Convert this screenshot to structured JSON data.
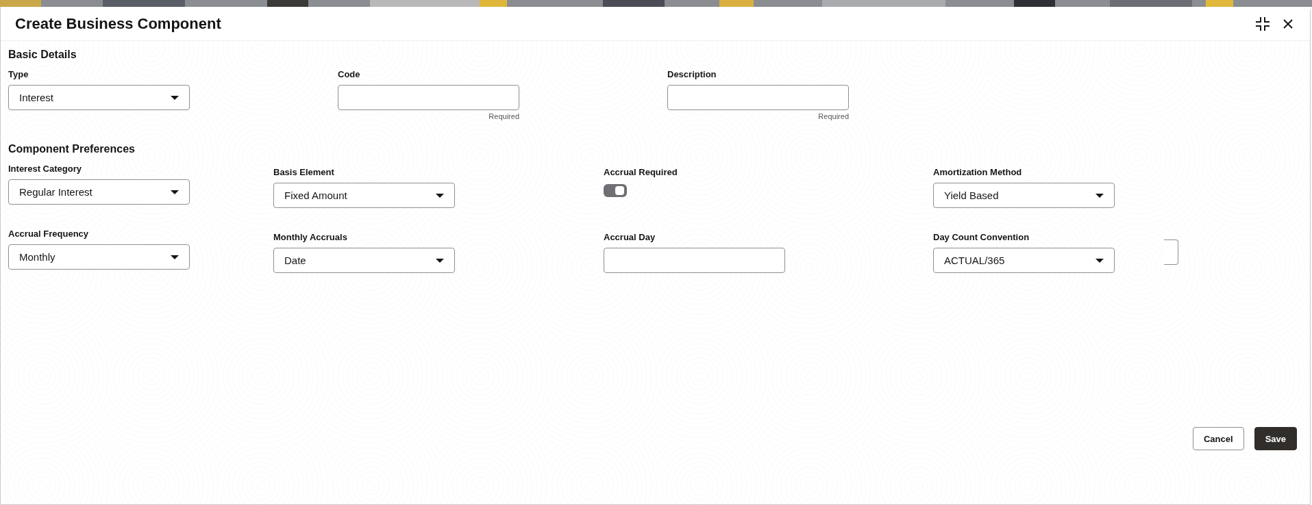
{
  "window": {
    "title": "Create Business Component"
  },
  "basic_details": {
    "heading": "Basic Details",
    "fields": [
      {
        "kind": "select",
        "label": "Type",
        "value": "Interest"
      },
      {
        "kind": "text",
        "label": "Code",
        "hint": "Required"
      },
      {
        "kind": "text",
        "label": "Description",
        "hint": "Required"
      }
    ]
  },
  "component_preferences": {
    "heading": "Component Preferences",
    "rows": [
      [
        {
          "kind": "select",
          "label": "Interest Category",
          "value": "Regular Interest"
        },
        {
          "kind": "select",
          "label": "Basis Element",
          "value": "Fixed Amount"
        },
        {
          "kind": "toggle",
          "label": "Accrual Required",
          "on": true
        },
        {
          "kind": "select",
          "label": "Amortization Method",
          "value": "Yield Based"
        }
      ],
      [
        {
          "kind": "select",
          "label": "Accrual Frequency",
          "value": "Monthly"
        },
        {
          "kind": "select",
          "label": "Monthly Accruals",
          "value": "Date"
        },
        {
          "kind": "text",
          "label": "Accrual Day"
        },
        {
          "kind": "select",
          "label": "Day Count Convention",
          "value": "ACTUAL/365"
        },
        {
          "kind": "partial"
        }
      ]
    ]
  },
  "buttons": [
    {
      "kind": "secondary",
      "label": "Cancel"
    },
    {
      "kind": "primary",
      "label": "Save"
    }
  ]
}
